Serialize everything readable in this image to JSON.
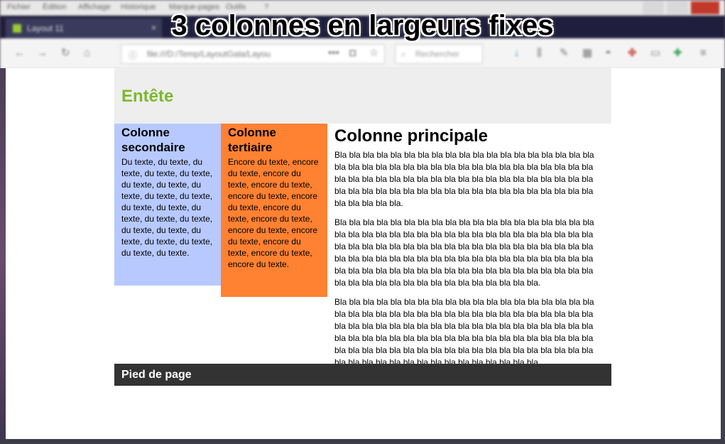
{
  "overlay_title": "3 colonnes en largeurs fixes",
  "browser": {
    "menu": [
      "Fichier",
      "Édition",
      "Affichage",
      "Historique",
      "Marque-pages",
      "Outils",
      "?"
    ],
    "tab_title": "Layout 11",
    "tab_close": "×",
    "url": "file:///D:/Temp/LayoutGala/Layou",
    "url_more": "•••",
    "search_placeholder": "Rechercher",
    "icons": [
      "back-icon",
      "forward-icon",
      "reload-icon",
      "home-icon",
      "info-icon",
      "pocket-icon",
      "bookmark-star-icon",
      "search-icon",
      "download-icon",
      "library-icon",
      "pen-icon",
      "grid-icon",
      "mask-icon",
      "extension-icon",
      "sidebar-icon",
      "addon-icon",
      "menu-icon"
    ]
  },
  "page": {
    "header_title": "Entête",
    "secondary": {
      "title": "Colonne secondaire",
      "text": "Du texte, du texte, du texte, du texte, du texte, du texte, du texte, du texte, du texte, du texte, du texte, du texte, du texte, du texte, du texte, du texte, du texte, du texte, du texte, du texte, du texte, du texte."
    },
    "tertiary": {
      "title": "Colonne tertiaire",
      "text": "Encore du texte, encore du texte, encore du texte, encore du texte, encore du texte, encore du texte, encore du texte, encore du texte, encore du texte, encore du texte, encore du texte, encore du texte, encore du texte."
    },
    "main": {
      "title": "Colonne principale",
      "paragraphs": [
        "Bla bla bla bla bla bla bla bla bla bla bla bla bla bla bla bla bla bla bla bla bla bla bla bla bla bla bla bla bla bla bla bla bla bla bla bla bla bla bla bla bla bla bla bla bla bla bla bla bla bla bla bla bla bla bla bla bla bla bla bla bla bla bla bla bla bla bla bla bla bla bla bla bla bla bla bla bla bla bla bla bla.",
        "Bla bla bla bla bla bla bla bla bla bla bla bla bla bla bla bla bla bla bla bla bla bla bla bla bla bla bla bla bla bla bla bla bla bla bla bla bla bla bla bla bla bla bla bla bla bla bla bla bla bla bla bla bla bla bla bla bla bla bla bla bla bla bla bla bla bla bla bla bla bla bla bla bla bla bla bla bla bla bla bla bla bla bla bla bla bla bla bla bla bla bla bla bla bla bla bla bla bla bla bla bla bla bla bla bla bla bla bla bla bla.",
        "Bla bla bla bla bla bla bla bla bla bla bla bla bla bla bla bla bla bla bla bla bla bla bla bla bla bla bla bla bla bla bla bla bla bla bla bla bla bla bla bla bla bla bla bla bla bla bla bla bla bla bla bla bla bla bla bla bla bla bla bla bla bla bla bla bla bla bla bla bla bla bla bla bla bla bla bla bla bla bla bla bla bla bla bla bla bla bla bla bla bla bla bla bla bla bla bla bla bla bla bla bla bla bla bla bla bla bla bla bla bla."
      ]
    },
    "footer": "Pied de page"
  },
  "colors": {
    "header_bg": "#eeeeee",
    "header_title": "#7cb82f",
    "secondary_bg": "#b7c9ff",
    "tertiary_bg": "#ff8132",
    "footer_bg": "#333333"
  }
}
